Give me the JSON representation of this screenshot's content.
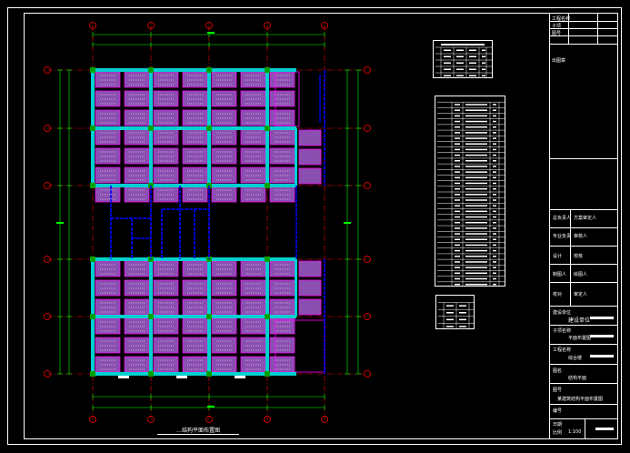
{
  "drawing": {
    "title": "…结构平面布置图",
    "axis_numbers_top": [
      "",
      "",
      "",
      "",
      ""
    ],
    "axis_letters_left": [
      "",
      "",
      "",
      "",
      "",
      ""
    ]
  },
  "title_block": {
    "header_left": [
      "工程名称",
      "子项",
      "图号"
    ],
    "header_right": [
      "",
      "",
      ""
    ],
    "stamp": "出图章",
    "rows": [
      {
        "label": "总负责人",
        "value": "方案审定人"
      },
      {
        "label": "专业负责",
        "value": "审核人"
      },
      {
        "label": "设计",
        "value": "校核"
      },
      {
        "label": "制图人",
        "value": "绘图人"
      },
      {
        "label": "校对",
        "value": "审定人"
      }
    ],
    "project_label": "建设单位",
    "project_name": "建设单位",
    "item_label": "子项名称",
    "item_name": "平面布置图",
    "building_label": "工程名称",
    "building_name": "综合楼",
    "drawing_label": "图名",
    "drawing_name": "结构平面",
    "sheet_label": "图号",
    "sheet_name": "某建筑结构平面布置图",
    "number_label": "编号",
    "number_value": "",
    "date_label": "日期",
    "date_value": "",
    "scale_label": "比例",
    "scale_value": "1:100"
  },
  "colors": {
    "grid": "#ff0000",
    "dim": "#00ff00",
    "slab": "#ff00ff",
    "beam": "#00d0d0",
    "wall": "#0000ff",
    "col": "#00a000",
    "fill": "#8a4fb0"
  }
}
